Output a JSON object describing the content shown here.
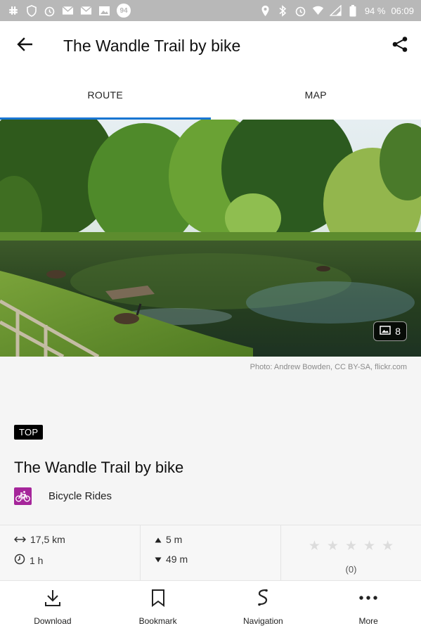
{
  "status_bar": {
    "notification_count": "94",
    "battery": "94 %",
    "time": "06:09"
  },
  "app_bar": {
    "title": "The Wandle Trail by bike"
  },
  "tabs": [
    {
      "label": "ROUTE",
      "active": true
    },
    {
      "label": "MAP",
      "active": false
    }
  ],
  "hero": {
    "photo_count": "8",
    "credit": "Photo: Andrew Bowden, CC BY-SA, flickr.com"
  },
  "route": {
    "badge": "TOP",
    "title": "The Wandle Trail by bike",
    "category": "Bicycle Rides",
    "category_color": "#a5259a"
  },
  "stats": {
    "distance": "17,5 km",
    "duration": "1 h",
    "ascent": "5 m",
    "descent": "49 m",
    "rating_count": "(0)",
    "rating_stars": 0
  },
  "bottom_bar": {
    "download": "Download",
    "bookmark": "Bookmark",
    "navigation": "Navigation",
    "more": "More"
  },
  "accent_color": "#1976d2"
}
